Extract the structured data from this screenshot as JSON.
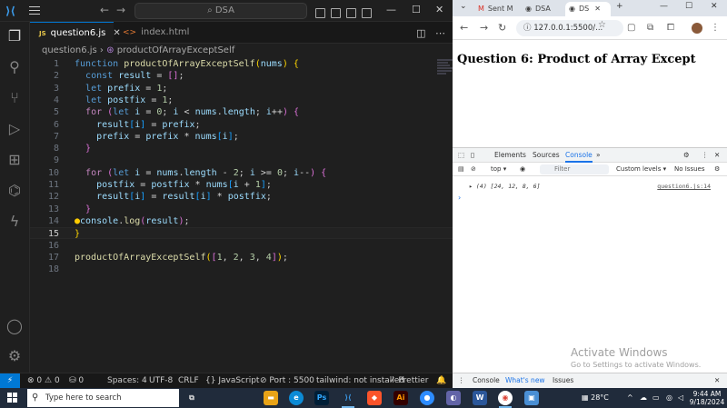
{
  "vscode": {
    "search": "DSA",
    "tabs": [
      {
        "label": "question6.js",
        "type": "JS"
      },
      {
        "label": "index.html"
      }
    ],
    "breadcrumb": {
      "file": "question6.js",
      "symbol": "productOfArrayExceptSelf"
    },
    "line_numbers": [
      "1",
      "2",
      "3",
      "4",
      "5",
      "6",
      "7",
      "8",
      "9",
      "10",
      "11",
      "12",
      "13",
      "14",
      "15",
      "16",
      "17",
      "18"
    ],
    "current_line": "15",
    "status": {
      "errors": "0",
      "warnings": "0",
      "ports_count": "0",
      "spaces": "Spaces: 4",
      "encoding": "UTF-8",
      "eol": "CRLF",
      "language": "JavaScript",
      "port": "Port : 5500",
      "tailwind": "tailwind: not installed",
      "prettier": "Prettier"
    }
  },
  "browser": {
    "tabs": [
      {
        "label": "Sent M"
      },
      {
        "label": "DSA"
      },
      {
        "label": "DS"
      }
    ],
    "url": "127.0.0.1:5500/...",
    "heading": "Question 6: Product of Array Except",
    "devtools": {
      "tabs": [
        "Elements",
        "Sources",
        "Console"
      ],
      "context": "top",
      "filter_placeholder": "Filter",
      "levels": "Custom levels",
      "issues": "No Issues",
      "console_output": "(4) [24, 12, 8, 6]",
      "console_source": "question6.js:14",
      "drawer_tabs": [
        "Console",
        "What's new",
        "Issues"
      ]
    },
    "watermark": {
      "title": "Activate Windows",
      "subtitle": "Go to Settings to activate Windows."
    }
  },
  "taskbar": {
    "search_placeholder": "Type here to search",
    "weather": "28°C",
    "time": "9:44 AM",
    "date": "9/18/2024"
  }
}
